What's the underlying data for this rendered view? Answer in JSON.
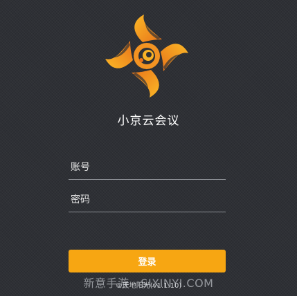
{
  "app": {
    "title": "小京云会议"
  },
  "login_form": {
    "account_placeholder": "账号",
    "account_value": "",
    "password_placeholder": "密码",
    "password_value": "",
    "login_label": "登录"
  },
  "footer": {
    "copyright": "©天地阳光(v1.1.10)"
  },
  "watermark": {
    "text": "新意手游 · SIXINYI.COM"
  },
  "icons": {
    "logo": "pinwheel-logo-icon"
  },
  "colors": {
    "background": "#2e3035",
    "accent": "#f7a612",
    "logo_orange": "#f08a1a",
    "logo_yellow": "#f9b226"
  }
}
